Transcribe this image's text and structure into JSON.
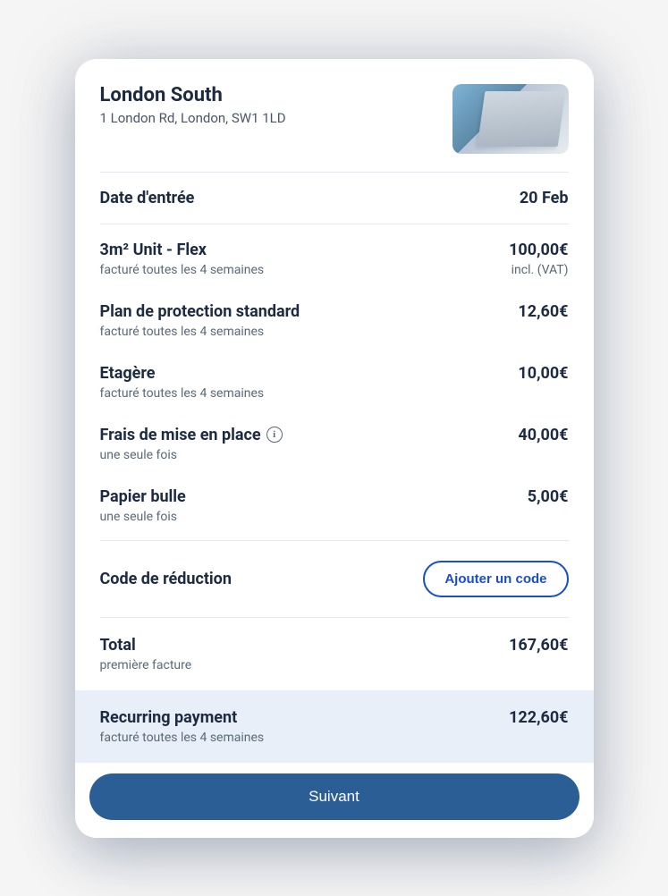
{
  "location": {
    "name": "London South",
    "address": "1 London Rd, London, SW1 1LD"
  },
  "move_in": {
    "label": "Date d'entrée",
    "value": "20 Feb"
  },
  "items": [
    {
      "title": "3m² Unit - Flex",
      "sub": "facturé toutes les 4 semaines",
      "price": "100,00€",
      "price_sub": "incl. (VAT)",
      "has_info": false
    },
    {
      "title": "Plan de protection standard",
      "sub": "facturé toutes les 4 semaines",
      "price": "12,60€",
      "price_sub": "",
      "has_info": false
    },
    {
      "title": "Etagère",
      "sub": "facturé toutes les 4 semaines",
      "price": "10,00€",
      "price_sub": "",
      "has_info": false
    },
    {
      "title": "Frais de mise en place",
      "sub": "une seule fois",
      "price": "40,00€",
      "price_sub": "",
      "has_info": true
    },
    {
      "title": "Papier bulle",
      "sub": "une seule fois",
      "price": "5,00€",
      "price_sub": "",
      "has_info": false
    }
  ],
  "promo": {
    "label": "Code de réduction",
    "button": "Ajouter un code"
  },
  "total": {
    "label": "Total",
    "sub": "première facture",
    "value": "167,60€"
  },
  "recurring": {
    "label": "Recurring payment",
    "sub": "facturé toutes les 4 semaines",
    "value": "122,60€"
  },
  "cta": {
    "label": "Suivant"
  }
}
